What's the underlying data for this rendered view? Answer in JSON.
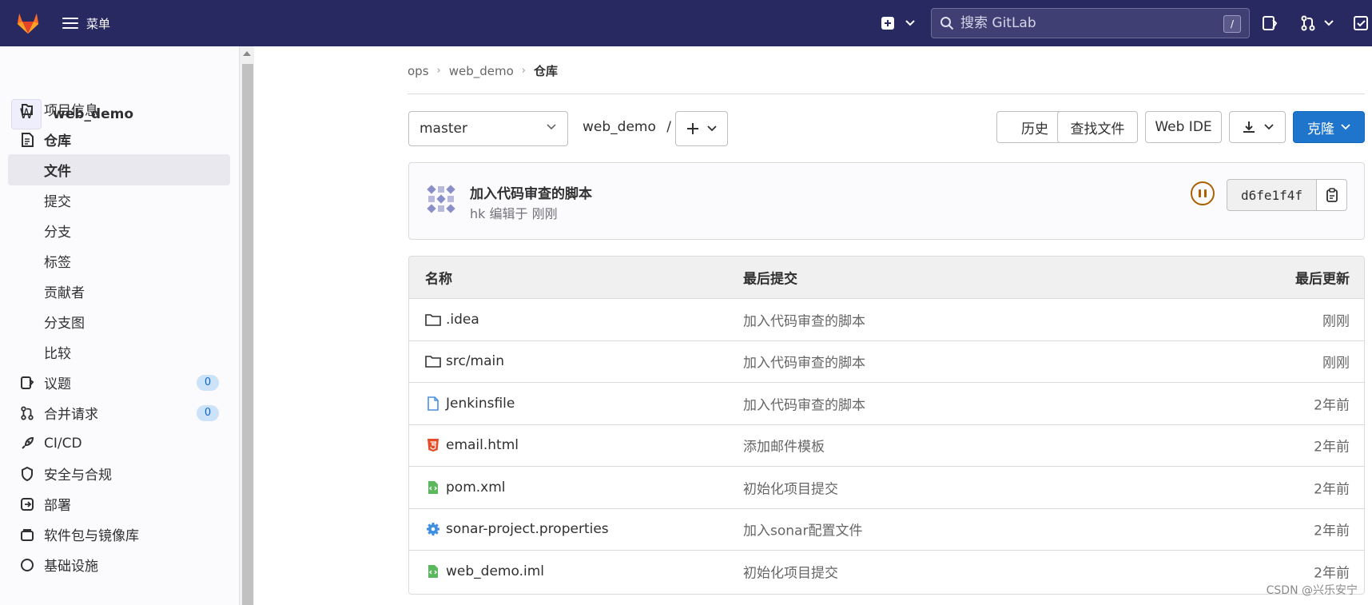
{
  "topbar": {
    "menu_label": "菜单",
    "search_placeholder": "搜索 GitLab",
    "search_shortcut": "/"
  },
  "sidebar": {
    "project_initial": "W",
    "project_name": "web_demo",
    "items": [
      {
        "label": "项目信息",
        "icon": "project-info-icon"
      },
      {
        "label": "仓库",
        "icon": "repository-icon"
      },
      {
        "label": "文件"
      },
      {
        "label": "提交"
      },
      {
        "label": "分支"
      },
      {
        "label": "标签"
      },
      {
        "label": "贡献者"
      },
      {
        "label": "分支图"
      },
      {
        "label": "比较"
      },
      {
        "label": "议题",
        "icon": "issues-icon",
        "badge": "0"
      },
      {
        "label": "合并请求",
        "icon": "merge-request-icon",
        "badge": "0"
      },
      {
        "label": "CI/CD",
        "icon": "rocket-icon"
      },
      {
        "label": "安全与合规",
        "icon": "shield-icon"
      },
      {
        "label": "部署",
        "icon": "deploy-icon"
      },
      {
        "label": "软件包与镜像库",
        "icon": "package-icon"
      },
      {
        "label": "基础设施",
        "icon": "infrastructure-icon"
      }
    ]
  },
  "breadcrumb": [
    "ops",
    "web_demo",
    "仓库"
  ],
  "repo": {
    "branch": "master",
    "path": "web_demo",
    "path_sep": "/",
    "buttons": {
      "history": "历史",
      "find_file": "查找文件",
      "web_ide": "Web IDE",
      "clone": "克隆"
    }
  },
  "commit": {
    "title": "加入代码审查的脚本",
    "meta": "hk 编辑于 刚刚",
    "sha": "d6fe1f4f"
  },
  "table": {
    "headers": {
      "name": "名称",
      "last_commit": "最后提交",
      "last_update": "最后更新"
    },
    "rows": [
      {
        "name": ".idea",
        "type": "folder",
        "commit": "加入代码审查的脚本",
        "updated": "刚刚"
      },
      {
        "name": "src/main",
        "type": "folder",
        "commit": "加入代码审查的脚本",
        "updated": "刚刚"
      },
      {
        "name": "Jenkinsfile",
        "type": "file",
        "commit": "加入代码审查的脚本",
        "updated": "2年前"
      },
      {
        "name": "email.html",
        "type": "html",
        "commit": "添加邮件模板",
        "updated": "2年前"
      },
      {
        "name": "pom.xml",
        "type": "code",
        "commit": "初始化项目提交",
        "updated": "2年前"
      },
      {
        "name": "sonar-project.properties",
        "type": "settings",
        "commit": "加入sonar配置文件",
        "updated": "2年前"
      },
      {
        "name": "web_demo.iml",
        "type": "code",
        "commit": "初始化项目提交",
        "updated": "2年前"
      }
    ]
  },
  "watermark": "CSDN @兴乐安宁",
  "colors": {
    "topbar": "#292961",
    "primary": "#1f75cb",
    "pipeline": "#ab6100"
  }
}
